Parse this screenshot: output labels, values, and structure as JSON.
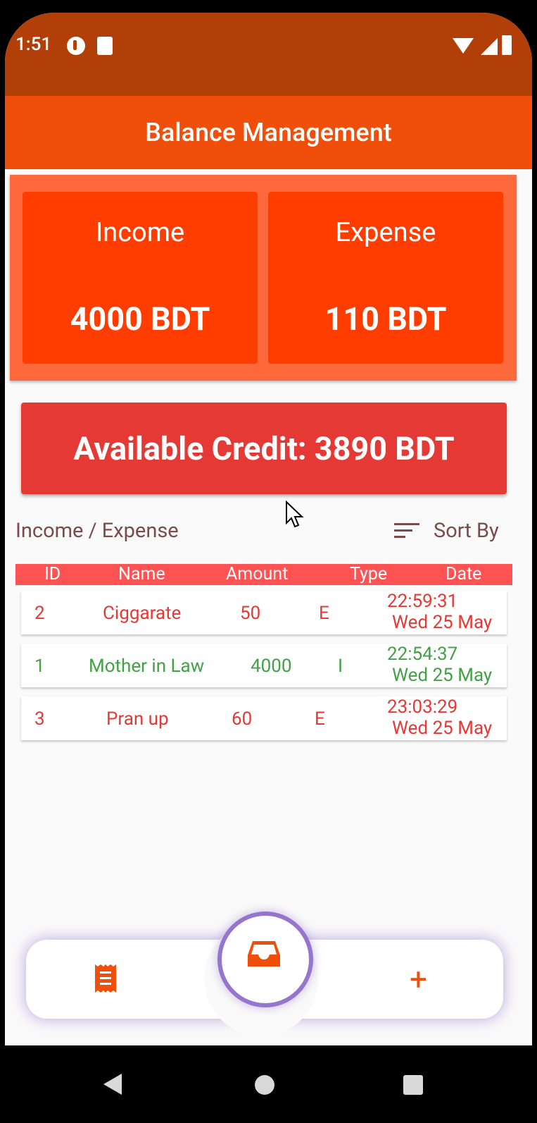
{
  "status_bar": {
    "time": "1:51"
  },
  "app_bar": {
    "title": "Balance Management"
  },
  "summary": {
    "income": {
      "label": "Income",
      "value": "4000 BDT"
    },
    "expense": {
      "label": "Expense",
      "value": "110 BDT"
    }
  },
  "credit": {
    "text": "Available Credit: 3890 BDT"
  },
  "list": {
    "title": "Income / Expense",
    "sort_label": "Sort By",
    "headers": [
      "ID",
      "Name",
      "Amount",
      "Type",
      "Date"
    ],
    "rows": [
      {
        "id": "2",
        "name": "Ciggarate",
        "amount": "50",
        "type": "E",
        "time": "22:59:31",
        "date": "Wed 25 May"
      },
      {
        "id": "1",
        "name": "Mother in Law",
        "amount": "4000",
        "type": "I",
        "time": "22:54:37",
        "date": "Wed 25 May"
      },
      {
        "id": "3",
        "name": "Pran up",
        "amount": "60",
        "type": "E",
        "time": "23:03:29",
        "date": "Wed 25 May"
      }
    ]
  },
  "colors": {
    "status_bar": "#b23f07",
    "app_bar": "#ef4f0a",
    "card": "#ff3d00",
    "card_container": "#ff6a3c",
    "credit": "#e53935",
    "expense_text": "#e53935",
    "income_text": "#43a047",
    "nav_glow": "#9575cd"
  },
  "bottom_nav": {
    "left_icon": "receipt-icon",
    "center_icon": "inbox-icon",
    "right_icon": "plus-icon"
  }
}
